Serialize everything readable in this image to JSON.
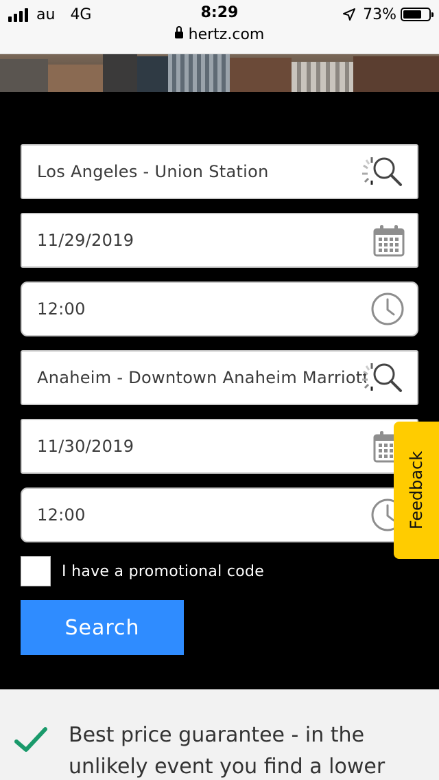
{
  "status_bar": {
    "carrier": "au",
    "network": "4G",
    "time": "8:29",
    "battery": "73%",
    "battery_level": 0.73,
    "url": "hertz.com"
  },
  "form": {
    "pickup_location": "Los Angeles - Union Station",
    "pickup_date": "11/29/2019",
    "pickup_time": "12:00",
    "return_location": "Anaheim - Downtown Anaheim Marriott",
    "return_date": "11/30/2019",
    "return_time": "12:00",
    "promo_label": "I have a promotional code",
    "search_label": "Search"
  },
  "feedback_label": "Feedback",
  "info": {
    "text": "Best price guarantee - in the unlikely event you find a lower"
  },
  "colors": {
    "accent": "#2f8cff",
    "feedback": "#ffcc00",
    "check": "#1a9a6b"
  },
  "icons": [
    "search-icon",
    "loading-spinner-icon",
    "calendar-icon",
    "clock-icon",
    "checkmark-icon",
    "lock-icon",
    "location-arrow-icon"
  ]
}
